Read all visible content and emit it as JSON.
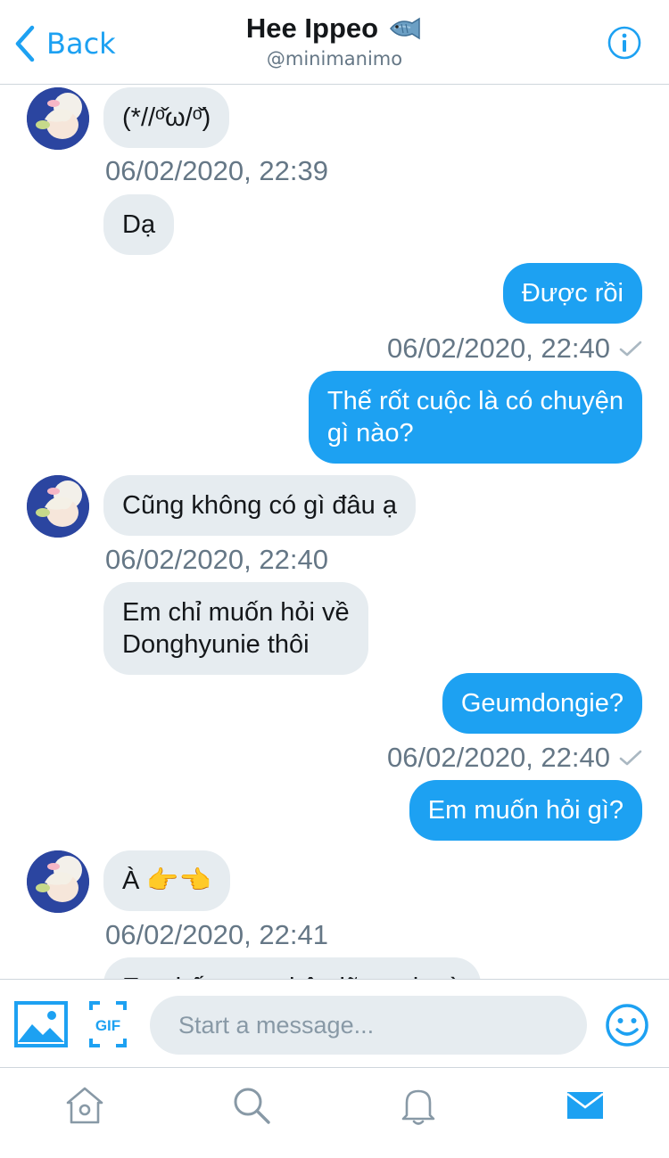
{
  "header": {
    "back_label": "Back",
    "contact_name": "Hee Ippeo",
    "contact_handle": "@minimanimo"
  },
  "messages": [
    {
      "side": "in",
      "text": "(*//ᵒ̌ω/ᵒ̌)"
    },
    {
      "side": "in",
      "timestamp": "06/02/2020, 22:39"
    },
    {
      "side": "in",
      "text": "Dạ"
    },
    {
      "side": "out",
      "text": "Được rồi"
    },
    {
      "side": "out",
      "timestamp": "06/02/2020, 22:40"
    },
    {
      "side": "out",
      "text_lines": [
        "Thế rốt cuộc là có chuyện",
        "gì nào?"
      ]
    },
    {
      "side": "in",
      "text": "Cũng không có gì đâu ạ"
    },
    {
      "side": "in",
      "timestamp": "06/02/2020, 22:40"
    },
    {
      "side": "in",
      "text_lines": [
        "Em chỉ muốn hỏi về",
        "Donghyunie thôi"
      ]
    },
    {
      "side": "out",
      "text": "Geumdongie?"
    },
    {
      "side": "out",
      "timestamp": "06/02/2020, 22:40"
    },
    {
      "side": "out",
      "text": "Em muốn hỏi gì?"
    },
    {
      "side": "in",
      "text": "À 👉👈"
    },
    {
      "side": "in",
      "timestamp": "06/02/2020, 22:41"
    },
    {
      "side": "in",
      "text": "Em thấy quan hệ giữa anh và"
    }
  ],
  "composer": {
    "placeholder": "Start a message..."
  },
  "icons": {
    "back": "chevron-left-icon",
    "title_emoji": "fish-icon",
    "info": "info-icon",
    "media": "image-icon",
    "gif": "gif-icon",
    "emoji": "smiley-icon",
    "tabs": [
      "home-icon",
      "search-icon",
      "bell-icon",
      "mail-icon"
    ]
  },
  "colors": {
    "accent": "#1da1f2",
    "incoming_bubble": "#e6ecf0",
    "secondary_text": "#657786",
    "inactive_icon": "#8899a6"
  },
  "tabs": {
    "active": "messages"
  }
}
